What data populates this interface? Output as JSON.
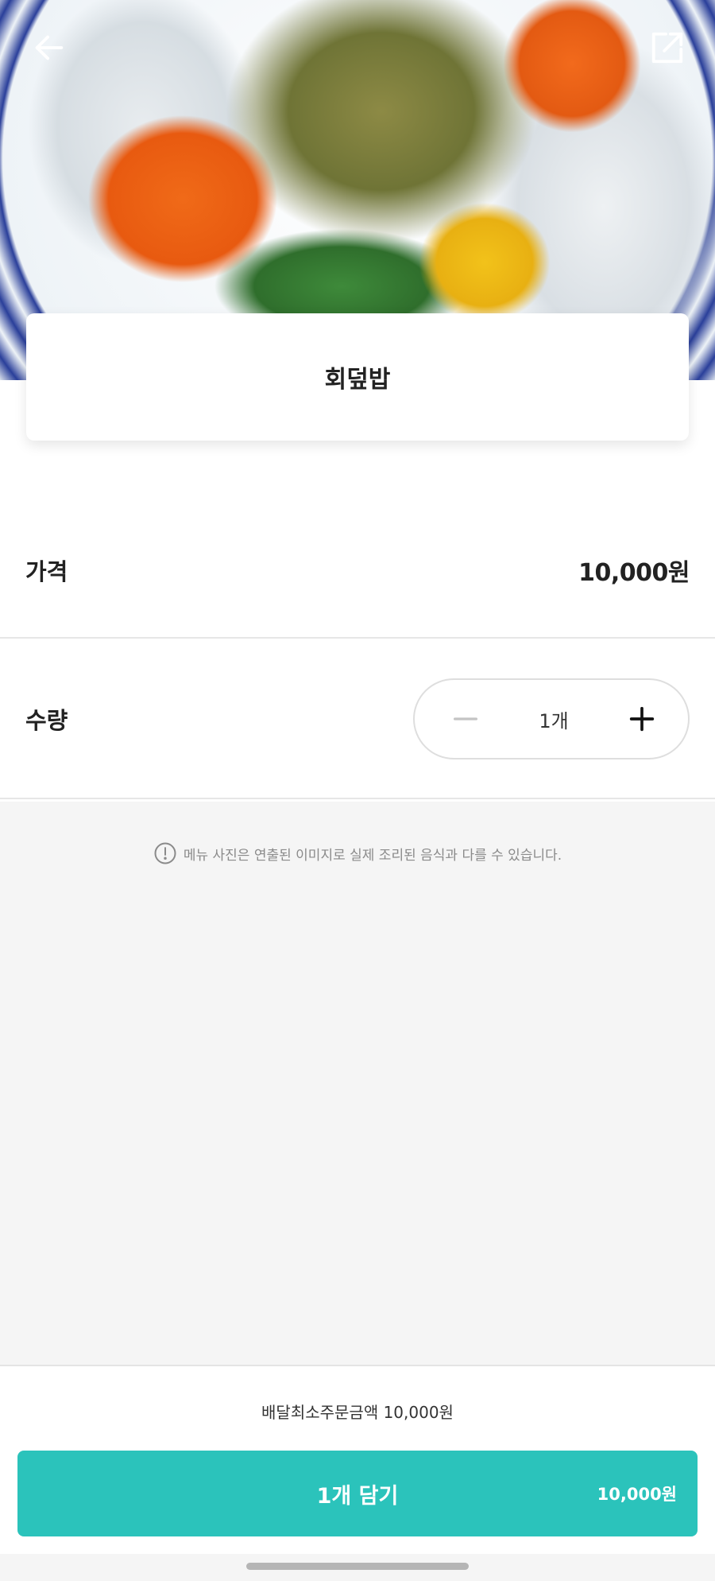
{
  "header": {
    "back_icon": "arrow-left-icon",
    "share_icon": "share-external-icon"
  },
  "menu": {
    "title": "회덮밥"
  },
  "price": {
    "label": "가격",
    "value": "10,000원"
  },
  "quantity": {
    "label": "수량",
    "value": "1개",
    "decrement_icon": "minus-icon",
    "increment_icon": "plus-icon"
  },
  "notice": {
    "icon": "info-exclamation-icon",
    "text": "메뉴 사진은 연출된 이미지로 실제 조리된 음식과 다를 수 있습니다."
  },
  "footer": {
    "min_order": "배달최소주문금액 10,000원",
    "cart_button_label": "1개 담기",
    "cart_button_total": "10,000원",
    "accent_color": "#2bc3bb"
  }
}
